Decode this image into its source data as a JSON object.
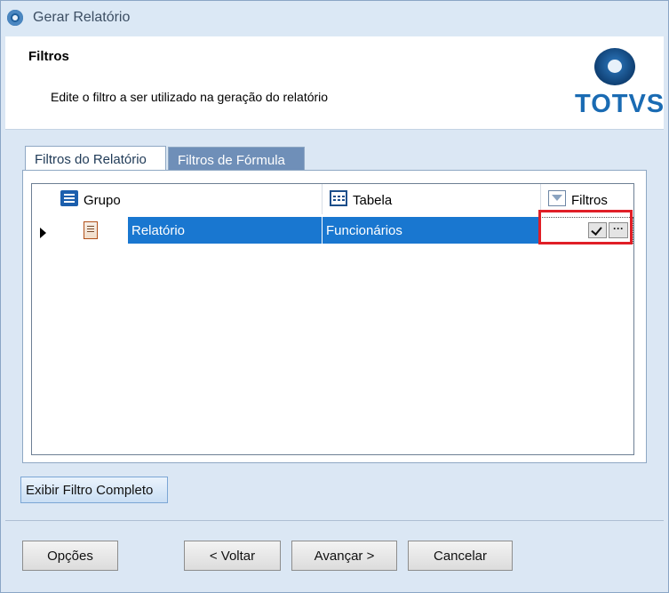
{
  "window": {
    "title": "Gerar Relatório",
    "icon": "totvs-app-icon"
  },
  "header": {
    "title": "Filtros",
    "description": "Edite o filtro a ser utilizado na geração do relatório",
    "logo_text": "TOTVS"
  },
  "tabs": [
    {
      "label": "Filtros do Relatório",
      "active": true
    },
    {
      "label": "Filtros de Fórmula",
      "active": false
    }
  ],
  "grid": {
    "columns": [
      {
        "label": "Grupo",
        "icon": "group-list-icon"
      },
      {
        "label": "Tabela",
        "icon": "table-icon"
      },
      {
        "label": "Filtros",
        "icon": "filter-funnel-icon"
      }
    ],
    "rows": [
      {
        "grupo": "Relatório",
        "tabela": "Funcionários",
        "selected": true,
        "icon": "report-notebook-icon"
      }
    ],
    "filter_buttons": {
      "confirm": "check-icon",
      "more": "···"
    }
  },
  "actions": {
    "show_full_filter": "Exibir Filtro Completo"
  },
  "footer": {
    "options": "Opções",
    "back": "< Voltar",
    "next": "Avançar >",
    "cancel": "Cancelar"
  },
  "colors": {
    "selection": "#1977d0",
    "highlight_border": "#e01e26",
    "logo": "#1a6bb3"
  }
}
